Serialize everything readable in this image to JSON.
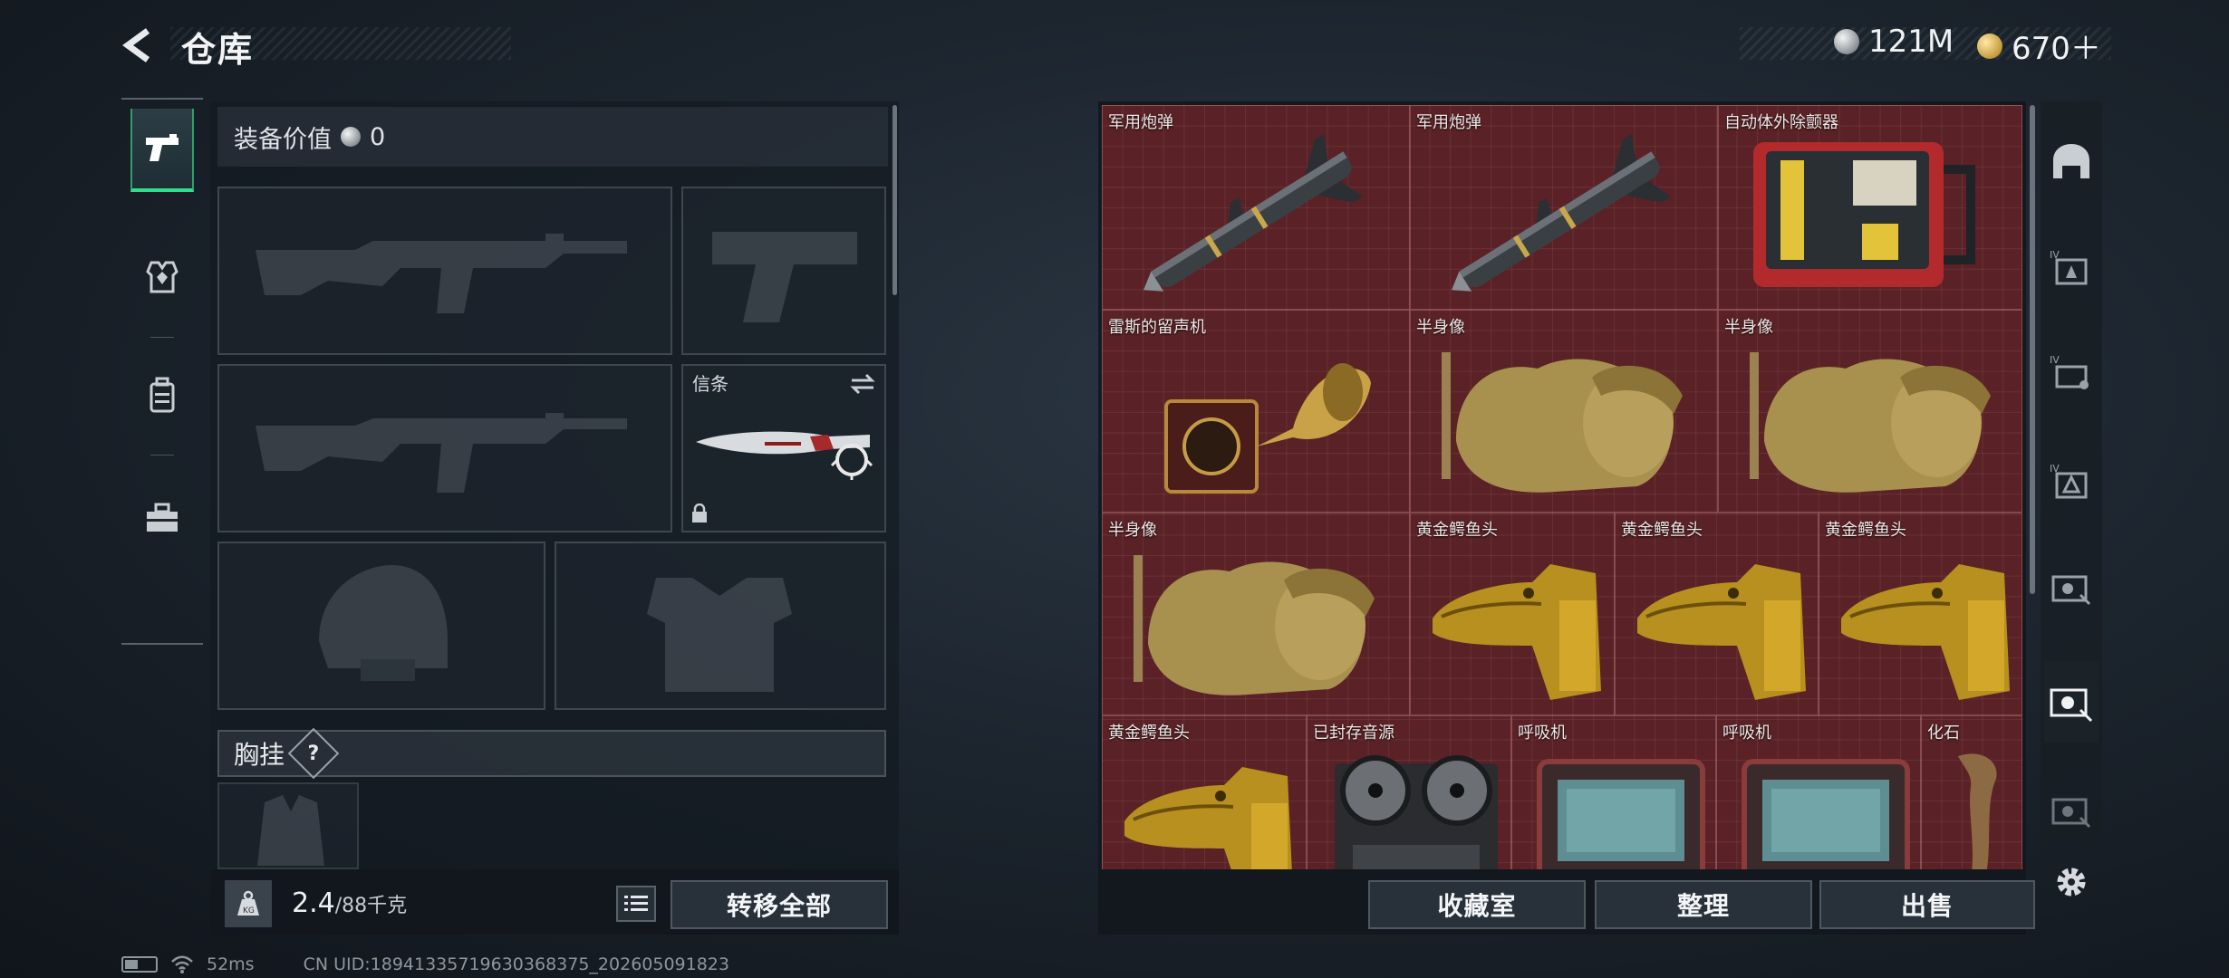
{
  "header": {
    "title": "仓库",
    "currencies": [
      {
        "icon": "silver-coin-icon",
        "value": "121M"
      },
      {
        "icon": "gold-coin-icon",
        "value": "670＋"
      }
    ]
  },
  "left_nav": [
    {
      "name": "weapons-tab",
      "icon": "pistol-icon",
      "active": true
    },
    {
      "name": "armor-tab",
      "icon": "armor-icon",
      "active": false
    },
    {
      "name": "backpack-tab",
      "icon": "backpack-icon",
      "active": false
    },
    {
      "name": "toolbox-tab",
      "icon": "toolbox-icon",
      "active": false
    }
  ],
  "equipment": {
    "value_label": "装备价值",
    "value": "0",
    "melee_slot_label": "信条",
    "chest_rig_label": "胸挂",
    "help_label": "?",
    "weight_current": "2.4",
    "weight_max": "/88千克",
    "transfer_all_label": "转移全部"
  },
  "storage": {
    "items": [
      {
        "label": "军用炮弹",
        "icon": "missile-icon"
      },
      {
        "label": "军用炮弹",
        "icon": "missile-icon"
      },
      {
        "label": "自动体外除颤器",
        "icon": "defibrillator-icon"
      },
      {
        "label": "雷斯的留声机",
        "icon": "gramophone-icon"
      },
      {
        "label": "半身像",
        "icon": "bust-icon"
      },
      {
        "label": "半身像",
        "icon": "bust-icon"
      },
      {
        "label": "半身像",
        "icon": "bust-icon"
      },
      {
        "label": "黄金鳄鱼头",
        "icon": "golden-crocodile-head-icon"
      },
      {
        "label": "黄金鳄鱼头",
        "icon": "golden-crocodile-head-icon"
      },
      {
        "label": "黄金鳄鱼头",
        "icon": "golden-crocodile-head-icon"
      },
      {
        "label": "黄金鳄鱼头",
        "icon": "golden-crocodile-head-icon"
      },
      {
        "label": "已封存音源",
        "icon": "reel-tape-recorder-icon"
      },
      {
        "label": "呼吸机",
        "icon": "ventilator-icon"
      },
      {
        "label": "呼吸机",
        "icon": "ventilator-icon"
      },
      {
        "label": "化石",
        "icon": "fossil-icon"
      }
    ],
    "buttons": {
      "collection": "收藏室",
      "sort": "整理",
      "sell": "出售"
    }
  },
  "footer": {
    "ping": "52ms",
    "uid": "CN UID:1894133571963036837​5_202605091823"
  },
  "colors": {
    "grid_bg": "#5a2226",
    "active_green": "#2fe08a"
  }
}
